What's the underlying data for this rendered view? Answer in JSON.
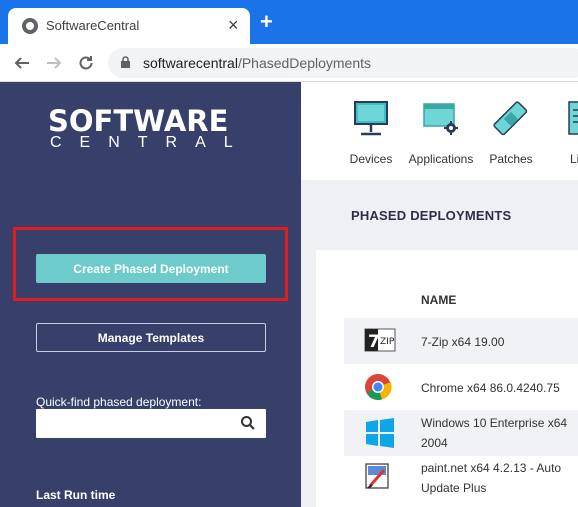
{
  "browser": {
    "tab_title": "SoftwareCentral",
    "tab_close": "×",
    "new_tab": "+",
    "url_host": "softwarecentral",
    "url_path": "/PhasedDeployments"
  },
  "sidebar": {
    "logo_top": "SOFTWARE",
    "logo_bottom": "CENTRAL",
    "create_button": "Create Phased Deployment",
    "manage_button": "Manage Templates",
    "quickfind_label": "Quick-find phased deployment:",
    "quickfind_value": "",
    "last_run_label": "Last Run time"
  },
  "topnav": {
    "items": [
      {
        "label": "Devices",
        "icon": "monitor-icon"
      },
      {
        "label": "Applications",
        "icon": "applications-icon"
      },
      {
        "label": "Patches",
        "icon": "patches-icon"
      },
      {
        "label": "Lice",
        "icon": "licenses-icon"
      }
    ]
  },
  "main": {
    "title": "PHASED DEPLOYMENTS",
    "column_name": "NAME",
    "rows": [
      {
        "name_line1": "7-Zip x64 19.00",
        "name_line2": "",
        "icon": "7zip-icon"
      },
      {
        "name_line1": "Chrome x64 86.0.4240.75",
        "name_line2": "",
        "icon": "chrome-icon"
      },
      {
        "name_line1": "Windows 10 Enterprise x64",
        "name_line2": "2004",
        "icon": "windows-icon"
      },
      {
        "name_line1": "paint.net x64 4.2.13 - Auto",
        "name_line2": "Update Plus",
        "icon": "paintnet-icon"
      }
    ]
  },
  "colors": {
    "sidebar_bg": "#36406a",
    "accent_teal": "#6ecbcb",
    "browser_blue": "#1a73e8",
    "highlight_red": "#e11b22"
  }
}
